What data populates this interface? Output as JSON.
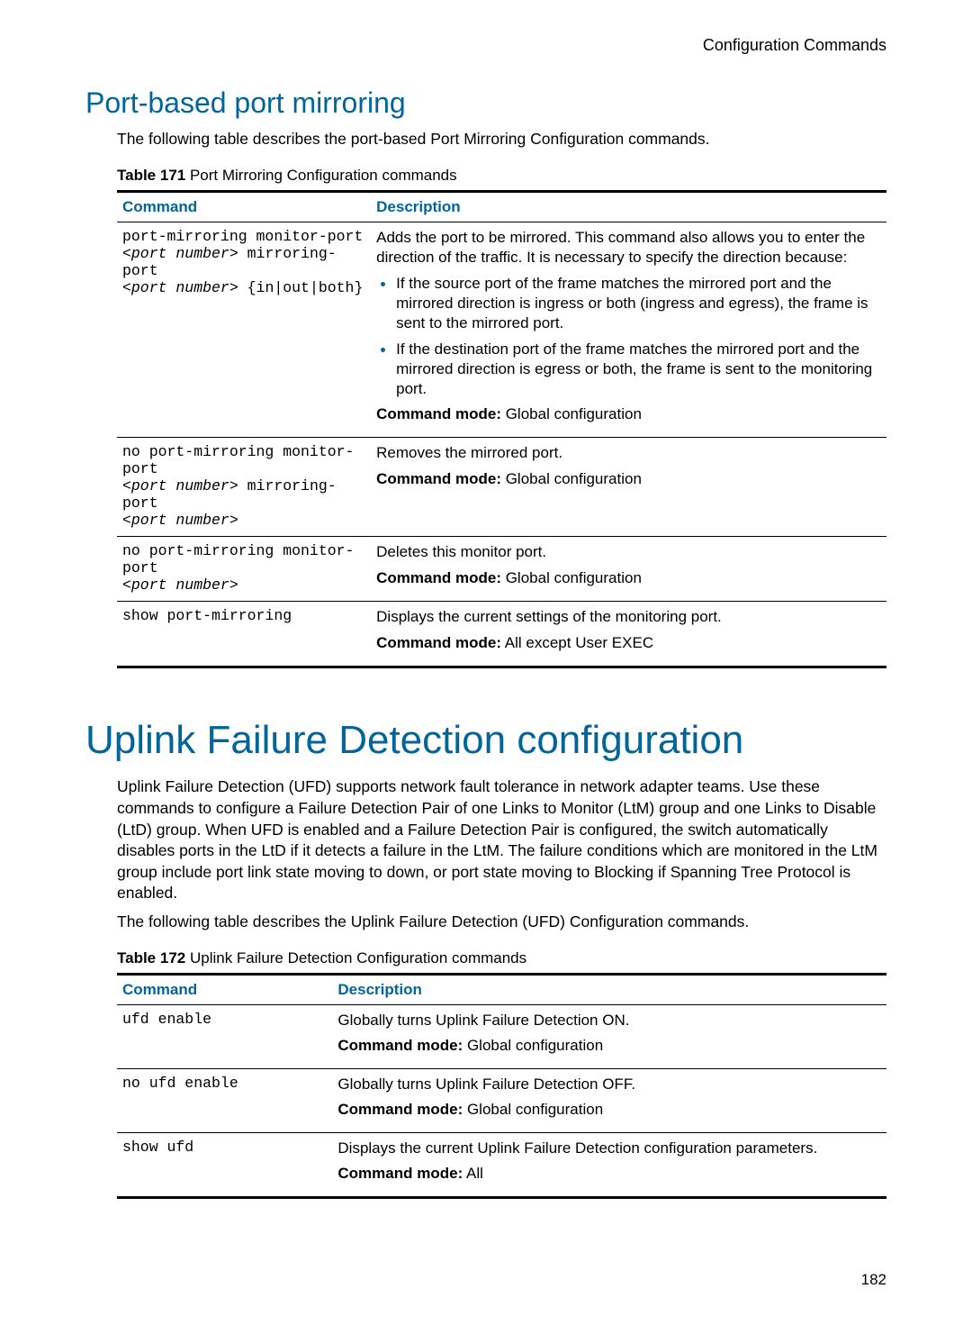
{
  "header": {
    "right": "Configuration Commands"
  },
  "section1": {
    "title": "Port-based port mirroring",
    "intro": "The following table describes the port-based Port Mirroring Configuration commands.",
    "table_caption_label": "Table 171",
    "table_caption_text": " Port Mirroring Configuration commands",
    "th_command": "Command",
    "th_description": "Description",
    "rows": {
      "r0": {
        "cmd_l1": "port-mirroring monitor-port",
        "cmd_l2a": "<port number>",
        "cmd_l2b": " mirroring-port",
        "cmd_l3a": "<port number>",
        "cmd_l3b": " {in|out|both}",
        "desc_intro": "Adds the port to be mirrored. This command also allows you to enter the direction of the traffic. It is necessary to specify the direction because:",
        "bullet1": "If the source port of the frame matches the mirrored port and the mirrored direction is ingress or both (ingress and egress), the frame is sent to the mirrored port.",
        "bullet2": "If the destination port of the frame matches the mirrored port and the mirrored direction is egress or both, the frame is sent to the monitoring port.",
        "mode_label": "Command mode:",
        "mode_value": " Global configuration"
      },
      "r1": {
        "cmd_l1": "no port-mirroring monitor-port",
        "cmd_l2a": "<port number>",
        "cmd_l2b": " mirroring-port",
        "cmd_l3a": "<port number>",
        "desc": "Removes the mirrored port.",
        "mode_label": "Command mode:",
        "mode_value": " Global configuration"
      },
      "r2": {
        "cmd_l1": "no port-mirroring monitor-port",
        "cmd_l2a": "<port number>",
        "desc": "Deletes this monitor port.",
        "mode_label": "Command mode:",
        "mode_value": " Global configuration"
      },
      "r3": {
        "cmd_l1": "show port-mirroring",
        "desc": "Displays the current settings of the monitoring port.",
        "mode_label": "Command mode:",
        "mode_value": " All except User EXEC"
      }
    }
  },
  "section2": {
    "title": "Uplink Failure Detection configuration",
    "para1": "Uplink Failure Detection (UFD) supports network fault tolerance in network adapter teams. Use these commands to configure a Failure Detection Pair of one Links to Monitor (LtM) group and one Links to Disable (LtD) group. When UFD is enabled and a Failure Detection Pair is configured, the switch automatically disables ports in the LtD if it detects a failure in the LtM. The failure conditions which are monitored in the LtM group include port link state moving to down, or port state moving to Blocking if Spanning Tree Protocol is enabled.",
    "para2": "The following table describes the Uplink Failure Detection (UFD) Configuration commands.",
    "table_caption_label": "Table 172",
    "table_caption_text": " Uplink Failure Detection Configuration commands",
    "th_command": "Command",
    "th_description": "Description",
    "rows": {
      "r0": {
        "cmd": "ufd enable",
        "desc": "Globally turns Uplink Failure Detection ON.",
        "mode_label": "Command mode:",
        "mode_value": " Global configuration"
      },
      "r1": {
        "cmd": "no ufd enable",
        "desc": "Globally turns Uplink Failure Detection OFF.",
        "mode_label": "Command mode:",
        "mode_value": " Global configuration"
      },
      "r2": {
        "cmd": "show ufd",
        "desc": "Displays the current Uplink Failure Detection configuration parameters.",
        "mode_label": "Command mode:",
        "mode_value": " All"
      }
    }
  },
  "page_number": "182"
}
